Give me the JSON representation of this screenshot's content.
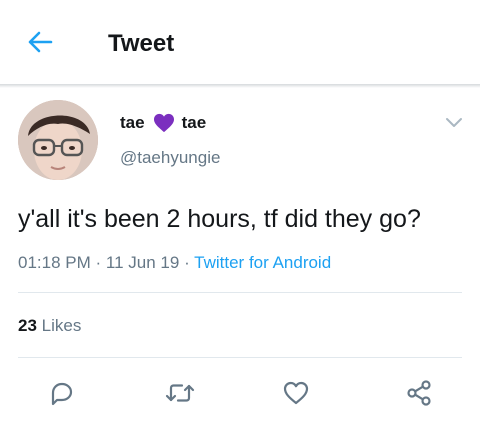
{
  "header": {
    "title": "Tweet",
    "back_icon": "arrow-left-icon"
  },
  "tweet": {
    "author_name_first": "tae",
    "author_name_second": "tae",
    "heart_color": "#7b2fbf",
    "handle": "@taehyungie",
    "text": "y'all it's been 2 hours, tf did they go?",
    "time": "01:18 PM",
    "date": "11 Jun 19",
    "source": "Twitter for Android",
    "separator": "·"
  },
  "stats": {
    "likes_count": "23",
    "likes_label": "Likes"
  },
  "actions": [
    "reply-icon",
    "retweet-icon",
    "like-icon",
    "share-icon"
  ],
  "colors": {
    "accent": "#1da1f2",
    "secondary_text": "#657786",
    "icon_gray": "#657786"
  }
}
